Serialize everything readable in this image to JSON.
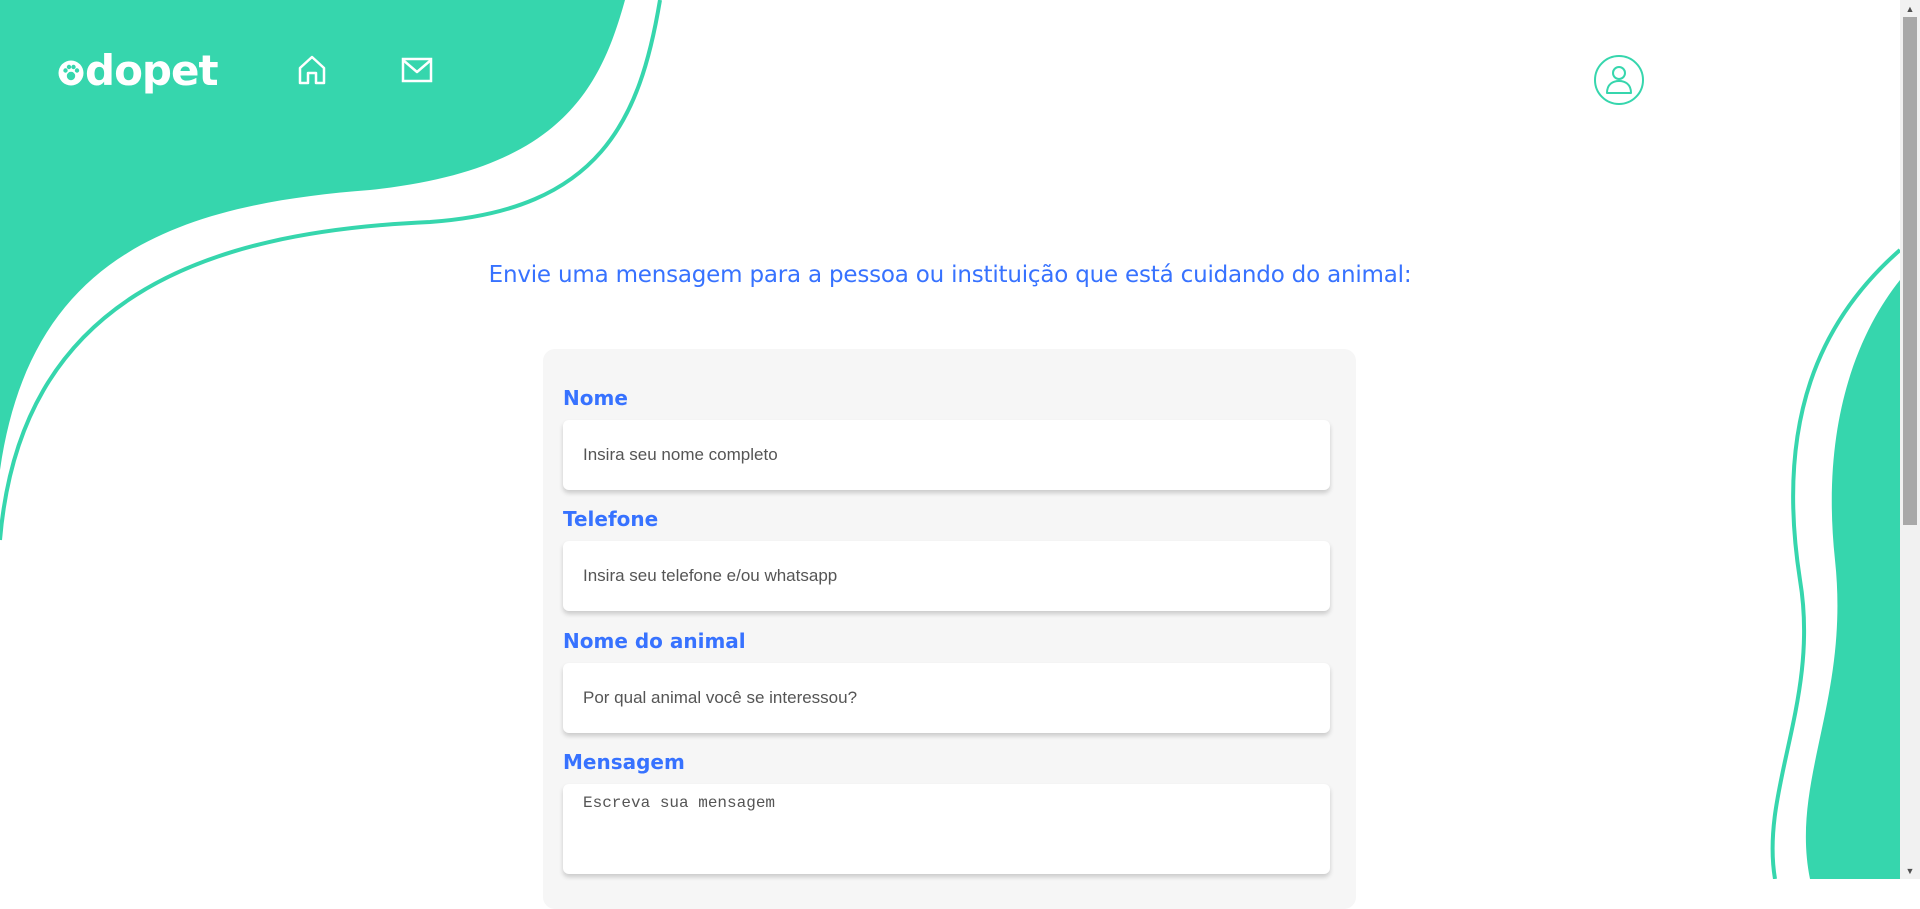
{
  "brand": {
    "logo_text": "dopet",
    "accent": "#36d6ad",
    "primary_text": "#3772ff"
  },
  "nav": {
    "home_icon": "home-icon",
    "mail_icon": "mail-icon",
    "avatar_icon": "user-avatar-icon"
  },
  "headline": "Envie uma mensagem para a pessoa ou instituição que está cuidando do animal:",
  "form": {
    "name": {
      "label": "Nome",
      "placeholder": "Insira seu nome completo"
    },
    "phone": {
      "label": "Telefone",
      "placeholder": "Insira seu telefone e/ou whatsapp"
    },
    "animal": {
      "label": "Nome do animal",
      "placeholder": "Por qual animal você se interessou?"
    },
    "message": {
      "label": "Mensagem",
      "placeholder": "Escreva sua mensagem"
    }
  }
}
